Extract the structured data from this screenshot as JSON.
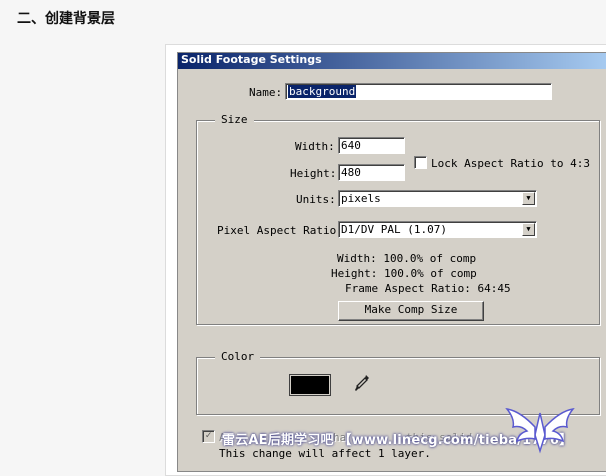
{
  "page": {
    "heading": "二、创建背景层"
  },
  "dialog": {
    "title": "Solid Footage Settings",
    "name_label": "Name:",
    "name_value": "background",
    "size": {
      "group_label": "Size",
      "width_label": "Width:",
      "width_value": "640",
      "height_label": "Height:",
      "height_value": "480",
      "lock_aspect_label": "Lock Aspect Ratio to 4:3",
      "lock_aspect_checked": false,
      "units_label": "Units:",
      "units_value": "pixels",
      "par_label": "Pixel Aspect Ratio:",
      "par_value": "D1/DV PAL (1.07)",
      "width_info": "Width:  100.0% of comp",
      "height_info": "Height:  100.0% of comp",
      "frame_aspect_info": "Frame Aspect Ratio:  64:45",
      "make_comp_size_label": "Make Comp Size"
    },
    "color": {
      "group_label": "Color",
      "swatch_color": "#000000",
      "eyedropper_icon": "eyedropper-icon"
    },
    "bottom": {
      "checkbox_checked": true,
      "partial_text_a": "A",
      "partial_text_b": "ha",
      "partial_text_c": "this solid",
      "change_note": "This change will affect 1 layer."
    }
  },
  "watermark": {
    "text": "雷云AE后期学习吧 【www.linecg.com/tieba/1776】",
    "logo_icon": "winged-logo-icon"
  }
}
